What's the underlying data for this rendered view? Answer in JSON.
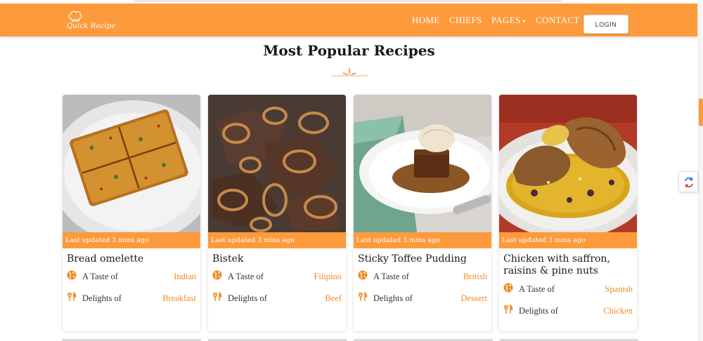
{
  "brand": {
    "name": "Quick Recipe",
    "icon": "chef-hat-icon"
  },
  "nav": {
    "items": [
      {
        "label": "HOME"
      },
      {
        "label": "CHIEFS"
      },
      {
        "label": "PAGES",
        "has_dropdown": true
      },
      {
        "label": "CONTACT"
      }
    ],
    "login_label": "LOGIN"
  },
  "section": {
    "title": "Most Popular Recipes"
  },
  "recipes": [
    {
      "title": "Bread omelette",
      "updated": "Last updated 3 mins ago",
      "taste_label": "A Taste of",
      "taste_value": "Indian",
      "delight_label": "Delights of",
      "delight_value": "Breakfast"
    },
    {
      "title": "Bistek",
      "updated": "Last updated 3 mins ago",
      "taste_label": "A Taste of",
      "taste_value": "Filipino",
      "delight_label": "Delights of",
      "delight_value": "Beef"
    },
    {
      "title": "Sticky Toffee Pudding",
      "updated": "Last updated 3 mins ago",
      "taste_label": "A Taste of",
      "taste_value": "British",
      "delight_label": "Delights of",
      "delight_value": "Dessert"
    },
    {
      "title": "Chicken with saffron, raisins & pine nuts",
      "updated": "Last updated 3 mins ago",
      "taste_label": "A Taste of",
      "taste_value": "Spanish",
      "delight_label": "Delights of",
      "delight_value": "Chicken"
    }
  ],
  "colors": {
    "accent": "#fd9a3c",
    "accent_text": "#f08a24"
  }
}
